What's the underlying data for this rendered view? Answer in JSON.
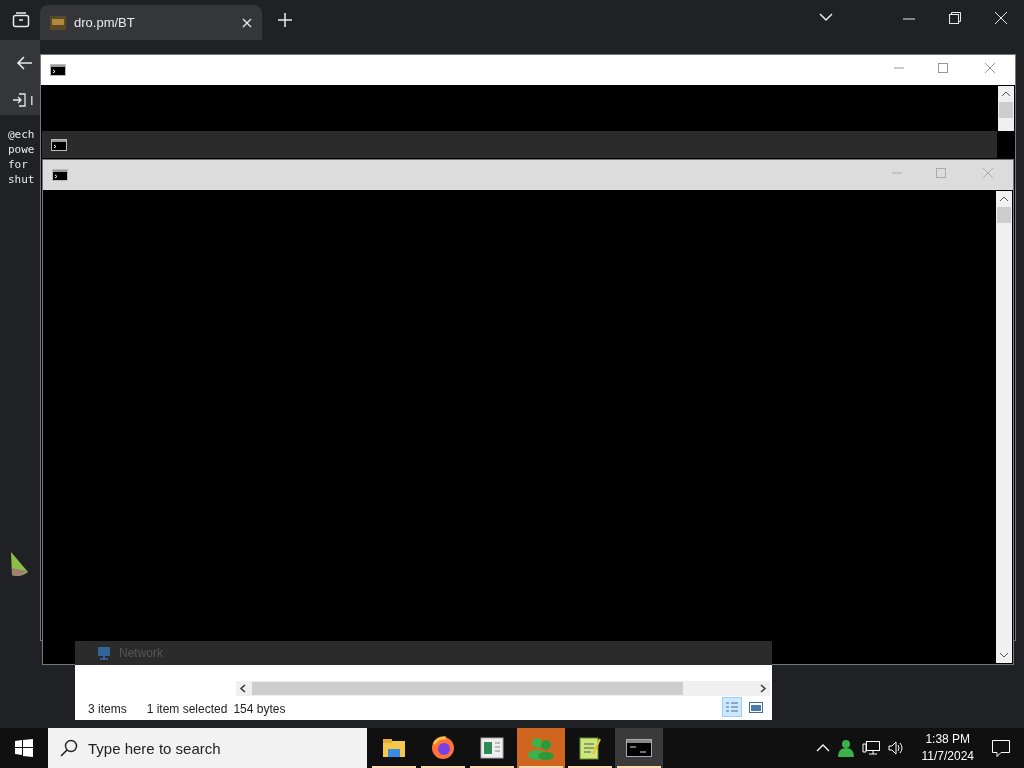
{
  "browser": {
    "tab": {
      "title": "dro.pm/BT",
      "selected": true
    },
    "toolbar_label": "I",
    "code_lines": [
      "@ech",
      "powe",
      "for",
      "shut"
    ]
  },
  "console_windows": [
    {
      "focused": true,
      "shaded": false
    },
    {
      "focused": false,
      "shaded": true
    },
    {
      "focused": false,
      "shaded": false
    }
  ],
  "explorer": {
    "nav_item": "Network",
    "status": {
      "count": "3 items",
      "selection": "1 item selected",
      "size": "154 bytes"
    },
    "views": [
      {
        "kind": "details",
        "selected": true
      },
      {
        "kind": "preview",
        "selected": false
      }
    ]
  },
  "taskbar": {
    "search": {
      "placeholder": "Type here to search"
    },
    "apps": [
      {
        "kind": "folder",
        "active": false,
        "flashing": false
      },
      {
        "kind": "browser",
        "active": false,
        "flashing": false
      },
      {
        "kind": "document",
        "active": false,
        "flashing": false
      },
      {
        "kind": "people",
        "active": false,
        "flashing": true
      },
      {
        "kind": "notepad",
        "active": false,
        "flashing": false
      },
      {
        "kind": "console",
        "active": true,
        "flashing": false
      }
    ],
    "clock": {
      "time": "1:38 PM",
      "date": "11/7/2024"
    }
  }
}
